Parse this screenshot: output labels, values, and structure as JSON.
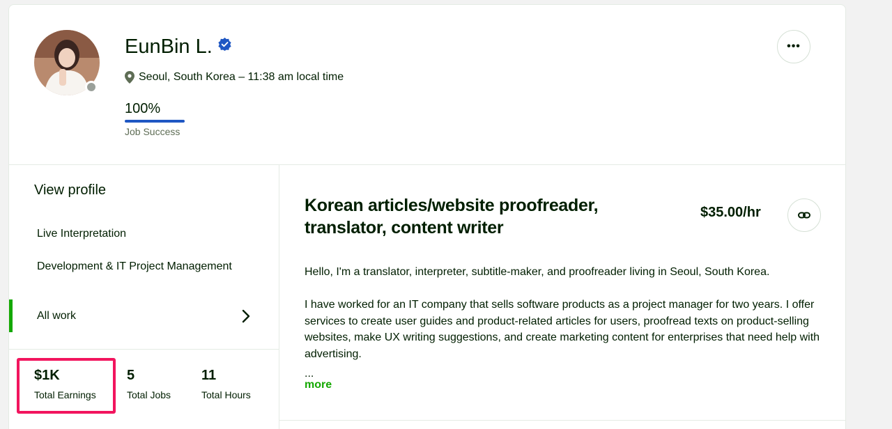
{
  "profile": {
    "name": "EunBin L.",
    "location": "Seoul, South Korea – 11:38 am local time",
    "job_success_value": "100%",
    "job_success_label": "Job Success",
    "job_success_fraction": 1.0
  },
  "sidebar": {
    "title": "View profile",
    "items": [
      {
        "label": "Live Interpretation"
      },
      {
        "label": "Development & IT Project Management"
      },
      {
        "label": "All work",
        "active": true
      }
    ]
  },
  "stats": [
    {
      "value": "$1K",
      "label": "Total Earnings"
    },
    {
      "value": "5",
      "label": "Total Jobs"
    },
    {
      "value": "11",
      "label": "Total Hours"
    }
  ],
  "main": {
    "title": "Korean articles/website proofreader, translator, content writer",
    "rate": "$35.00/hr",
    "description": [
      "Hello, I'm a translator, interpreter, subtitle-maker, and proofreader living in Seoul, South Korea.",
      "I have worked for an IT company that sells software products as a project manager for two years. I offer services to create user guides and product-related articles for users, proofread texts on product-selling websites, make UX writing suggestions, and create marketing content for enterprises that need help with advertising."
    ],
    "ellipsis": "...",
    "more_label": "more"
  },
  "colors": {
    "accent_green": "#14a800",
    "verified_blue": "#1f57c3",
    "highlight_pink": "#f2155e"
  }
}
